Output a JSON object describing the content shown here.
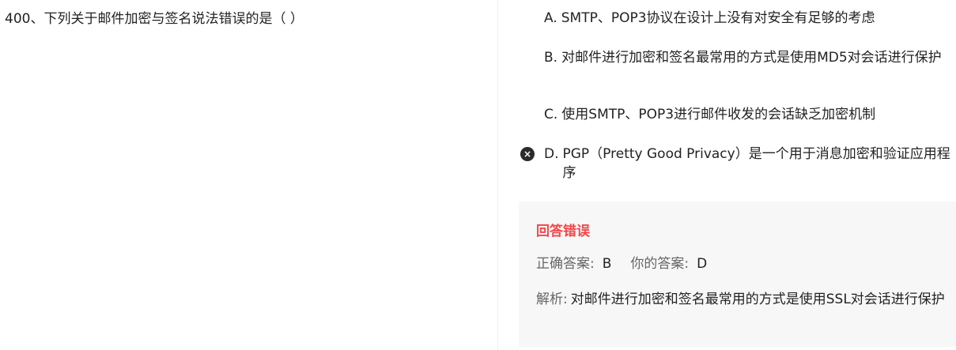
{
  "question": {
    "text": "400、下列关于邮件加密与签名说法错误的是（ ）"
  },
  "options": [
    {
      "letter": "A.",
      "text": "SMTP、POP3协议在设计上没有对安全有足够的考虑"
    },
    {
      "letter": "B.",
      "text": "对邮件进行加密和签名最常用的方式是使用MD5对会话进行保护"
    },
    {
      "letter": "C.",
      "text": "使用SMTP、POP3进行邮件收发的会话缺乏加密机制"
    },
    {
      "letter": "D.",
      "text": "PGP（Pretty Good Privacy）是一个用于消息加密和验证应用程序",
      "selected_icon": "×"
    }
  ],
  "result": {
    "title": "回答错误",
    "correct_label": "正确答案:",
    "correct_value": "B",
    "your_label": "你的答案:",
    "your_value": "D",
    "analysis_label": "解析:",
    "analysis_text": "对邮件进行加密和签名最常用的方式是使用SSL对会话进行保护"
  },
  "colors": {
    "error_red": "#f2474a",
    "panel_bg": "#f7f7f7"
  }
}
